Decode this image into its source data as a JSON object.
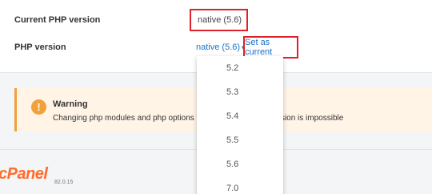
{
  "settings": {
    "current_label": "Current PHP version",
    "current_value": "native (5.6)",
    "php_label": "PHP version",
    "select_value": "native (5.6)",
    "set_current_label": "Set as current"
  },
  "warning": {
    "title": "Warning",
    "text_left": "Changing php modules and php options via PH",
    "text_right": "version is impossible"
  },
  "dropdown": {
    "options": [
      "5.2",
      "5.3",
      "5.4",
      "5.5",
      "5.6",
      "7.0"
    ]
  },
  "footer": {
    "logo": "cPanel",
    "version": "82.0.15"
  }
}
